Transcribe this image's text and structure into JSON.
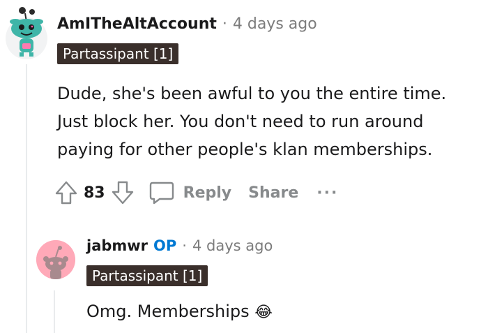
{
  "comments": [
    {
      "username": "AmITheAltAccount",
      "separator": "·",
      "time": "4 days ago",
      "flair": "Partassipant [1]",
      "body_lines": [
        "Dude, she's been awful to you the entire time.",
        "Just block her. You don't need to run around",
        "paying for other people's klan memberships."
      ],
      "score": "83",
      "reply_label": "Reply",
      "share_label": "Share",
      "more_label": "···",
      "avatar_color": "#3fb5a8"
    },
    {
      "username": "jabmwr",
      "op_badge": "OP",
      "separator": "·",
      "time": "4 days ago",
      "flair": "Partassipant [1]",
      "body": "Omg. Memberships",
      "emoji": "😂",
      "avatar_color": "#ffa9b8"
    }
  ],
  "colors": {
    "op_blue": "#0079d3",
    "flair_bg": "#3a2f2b",
    "meta_gray": "#7c7c7c",
    "action_gray": "#878a8c",
    "thread_line": "#e9ebed"
  }
}
